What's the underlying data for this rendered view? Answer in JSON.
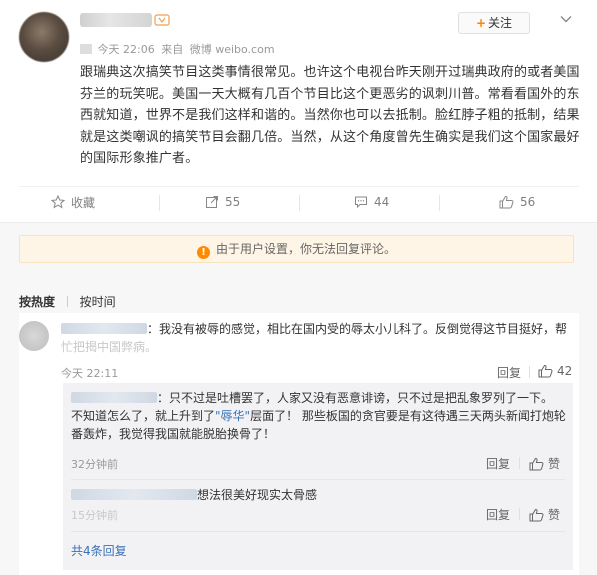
{
  "post": {
    "time": "今天 22:06",
    "source_prefix": "来自",
    "source": "微博 weibo.com",
    "follow_label": "关注",
    "content": "跟瑞典这次搞笑节目这类事情很常见。也许这个电视台昨天刚开过瑞典政府的或者美国芬兰的玩笑呢。美国一天大概有几百个节目比这个更恶劣的讽刺川普。常看看国外的东西就知道，世界不是我们这样和谐的。当然你也可以去抵制。脸红脖子粗的抵制，结果就是这类嘲讽的搞笑节目会翻几倍。当然，从这个角度曾先生确实是我们这个国家最好的国际形象推广者。",
    "actions": {
      "favorite_label": "收藏",
      "repost_count": "55",
      "comment_count": "44",
      "like_count": "56"
    }
  },
  "notice": "由于用户设置，你无法回复评论。",
  "sort": {
    "hot_label": "按热度",
    "time_label": "按时间"
  },
  "comments": [
    {
      "text": "：我没有被辱的感觉，相比在国内受的辱太小儿科了。反倒觉得这节目挺好，帮",
      "text_obscured": "忙把揭中国弊病。",
      "time": "今天 22:11",
      "reply_label": "回复",
      "like_count": "42",
      "replies": [
        {
          "text_line1": "：只不过是吐槽罢了，人家又没有恶意诽谤，只不过是把乱象罗列了一下。",
          "text_line2_prefix": "不知道怎么了，就上升到了",
          "text_line2_quote": "\"辱华\"",
          "text_line2_suffix": "层面了！ 那些板国的贪官要是有这待遇三天两头新闻打炮轮",
          "text_line3": "番轰炸，我觉得我国就能脱胎换骨了！",
          "time": "32分钟前",
          "reply_label": "回复",
          "like_label": "赞"
        },
        {
          "text": "想法很美好现实太骨感",
          "time": "15分钟前",
          "reply_label": "回复",
          "like_label": "赞"
        }
      ],
      "more_replies": "共4条回复"
    }
  ],
  "colors": {
    "accent": "#ff8200",
    "link": "#3a72b6",
    "notice_bg": "#fff5e6"
  }
}
